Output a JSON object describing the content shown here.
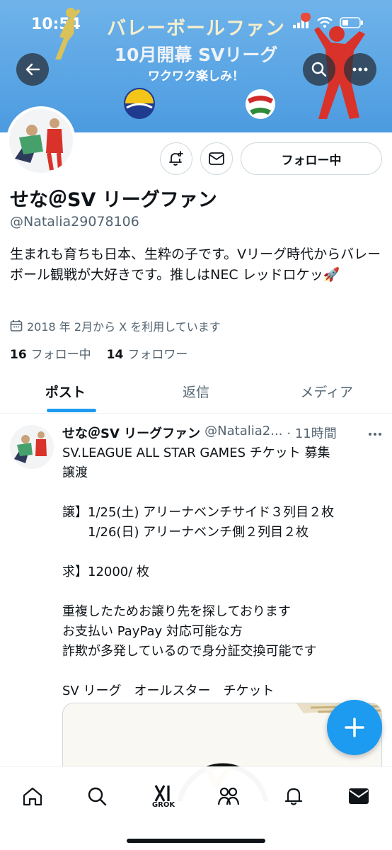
{
  "status_bar": {
    "time": "10:54"
  },
  "banner": {
    "line1": "バレーボールファン",
    "line2": "10月開幕 SVリーグ",
    "line3": "ワクワク楽しみ！"
  },
  "profile": {
    "follow_button": "フォロー中",
    "display_name": "せな＠SV リーグファン",
    "handle": "@Natalia29078106",
    "bio": "生まれも育ちも日本、生粋の子です。Vリーグ時代からバレーボール観戦が大好きです。推しはNEC レッドロケッ🚀",
    "joined": "2018 年 2月から X を利用しています",
    "following_count": "16",
    "following_label": "フォロー中",
    "followers_count": "14",
    "followers_label": "フォロワー"
  },
  "tabs": [
    {
      "label": "ポスト"
    },
    {
      "label": "返信"
    },
    {
      "label": "メディア"
    }
  ],
  "post": {
    "author": "せな＠SV リーグファン",
    "handle": "@Natalia2...",
    "time": "· 11時間",
    "body": "SV.LEAGUE ALL STAR GAMES チケット 募集\n譲渡\n\n譲】1/25(土) アリーナベンチサイド３列目２枚\n　　1/26(日) アリーナベンチ側２列目２枚\n\n求】12000/ 枚\n\n重複したためお譲り先を探しております\nお支払い PayPay 対応可能な方\n詐欺が多発しているので身分証交換可能です\n\nSV リーグ　オールスター　チケット"
  },
  "bottom_nav": {
    "grok_label": "GROK"
  },
  "icons": [
    "back-arrow-icon",
    "search-icon",
    "more-icon",
    "notification-bell-plus-icon",
    "mail-icon",
    "calendar-icon",
    "compose-plus-icon",
    "home-icon",
    "grok-icon",
    "communities-icon",
    "bell-icon",
    "messages-icon"
  ],
  "colors": {
    "accent": "#1d9bf0",
    "text": "#0f1419",
    "muted": "#536471",
    "banner": "#5aa6e6"
  }
}
